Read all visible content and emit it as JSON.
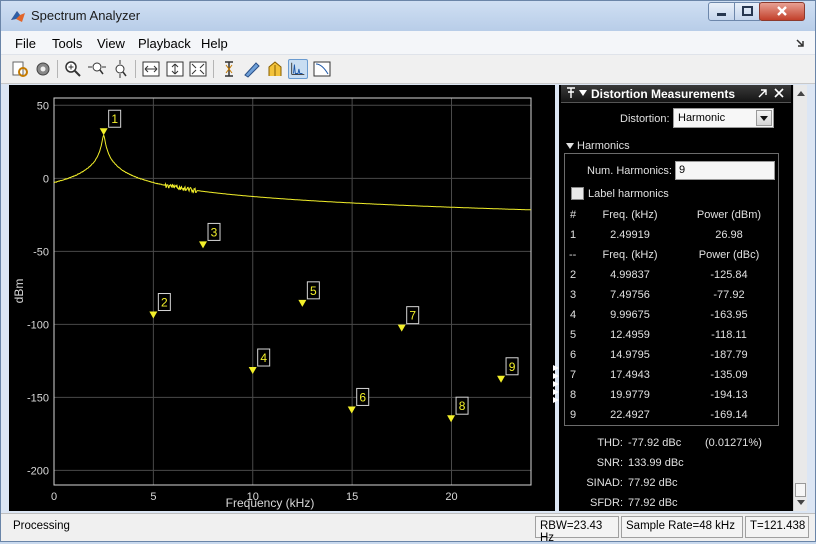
{
  "window": {
    "title": "Spectrum Analyzer",
    "menu": [
      "File",
      "Tools",
      "View",
      "Playback",
      "Help"
    ]
  },
  "toolbar_icons": [
    "print-preview-icon",
    "settings-icon",
    "zoom-in-icon",
    "zoom-x-icon",
    "zoom-y-icon",
    "scale-x-icon",
    "scale-y-icon",
    "autoscale-icon",
    "data-cursor-icon",
    "peak-finder-icon",
    "cursor-measure-icon",
    "distortion-measure-icon",
    "ccdf-icon"
  ],
  "chart_data": {
    "type": "line",
    "xlabel": "Frequency (kHz)",
    "ylabel": "dBm",
    "xlim": [
      0,
      24
    ],
    "ylim": [
      -210,
      55
    ],
    "xticks": [
      0,
      5,
      10,
      15,
      20
    ],
    "yticks": [
      50,
      0,
      -50,
      -100,
      -150,
      -200
    ],
    "grid": true,
    "trace_color": "#f2ef2a",
    "noise_floor_dbm": -160,
    "markers": [
      {
        "label": "1",
        "x": 2.49919,
        "y": 29.5
      },
      {
        "label": "2",
        "x": 4.99837,
        "y": -96
      },
      {
        "label": "3",
        "x": 7.49756,
        "y": -48
      },
      {
        "label": "4",
        "x": 9.99675,
        "y": -134
      },
      {
        "label": "5",
        "x": 12.4959,
        "y": -88
      },
      {
        "label": "6",
        "x": 14.9795,
        "y": -161
      },
      {
        "label": "7",
        "x": 17.4943,
        "y": -105
      },
      {
        "label": "8",
        "x": 19.9779,
        "y": -167
      },
      {
        "label": "9",
        "x": 22.4927,
        "y": -140
      }
    ]
  },
  "panel": {
    "title": "Distortion Measurements",
    "distortion_label": "Distortion:",
    "distortion_value": "Harmonic",
    "harmonics_header": "Harmonics",
    "num_harmonics_label": "Num. Harmonics:",
    "num_harmonics_value": "9",
    "label_harmonics": "Label harmonics",
    "col_hash": "#",
    "col_freq": "Freq. (kHz)",
    "col_power_dbm": "Power (dBm)",
    "fundamental": {
      "n": "1",
      "freq": "2.49919",
      "power": "26.98"
    },
    "sep_hash": "--",
    "col_power_dbc": "Power (dBc)",
    "harmonics": [
      {
        "n": "2",
        "freq": "4.99837",
        "power": "-125.84"
      },
      {
        "n": "3",
        "freq": "7.49756",
        "power": "-77.92"
      },
      {
        "n": "4",
        "freq": "9.99675",
        "power": "-163.95"
      },
      {
        "n": "5",
        "freq": "12.4959",
        "power": "-118.11"
      },
      {
        "n": "6",
        "freq": "14.9795",
        "power": "-187.79"
      },
      {
        "n": "7",
        "freq": "17.4943",
        "power": "-135.09"
      },
      {
        "n": "8",
        "freq": "19.9779",
        "power": "-194.13"
      },
      {
        "n": "9",
        "freq": "22.4927",
        "power": "-169.14"
      }
    ],
    "summary": [
      {
        "label": "THD:",
        "value": "-77.92 dBc",
        "extra": "(0.01271%)"
      },
      {
        "label": "SNR:",
        "value": "133.99 dBc",
        "extra": ""
      },
      {
        "label": "SINAD:",
        "value": "77.92 dBc",
        "extra": ""
      },
      {
        "label": "SFDR:",
        "value": "77.92 dBc",
        "extra": ""
      }
    ]
  },
  "status": {
    "state": "Processing",
    "rbw": "RBW=23.43 Hz",
    "sample_rate": "Sample Rate=48 kHz",
    "time": "T=121.438"
  }
}
